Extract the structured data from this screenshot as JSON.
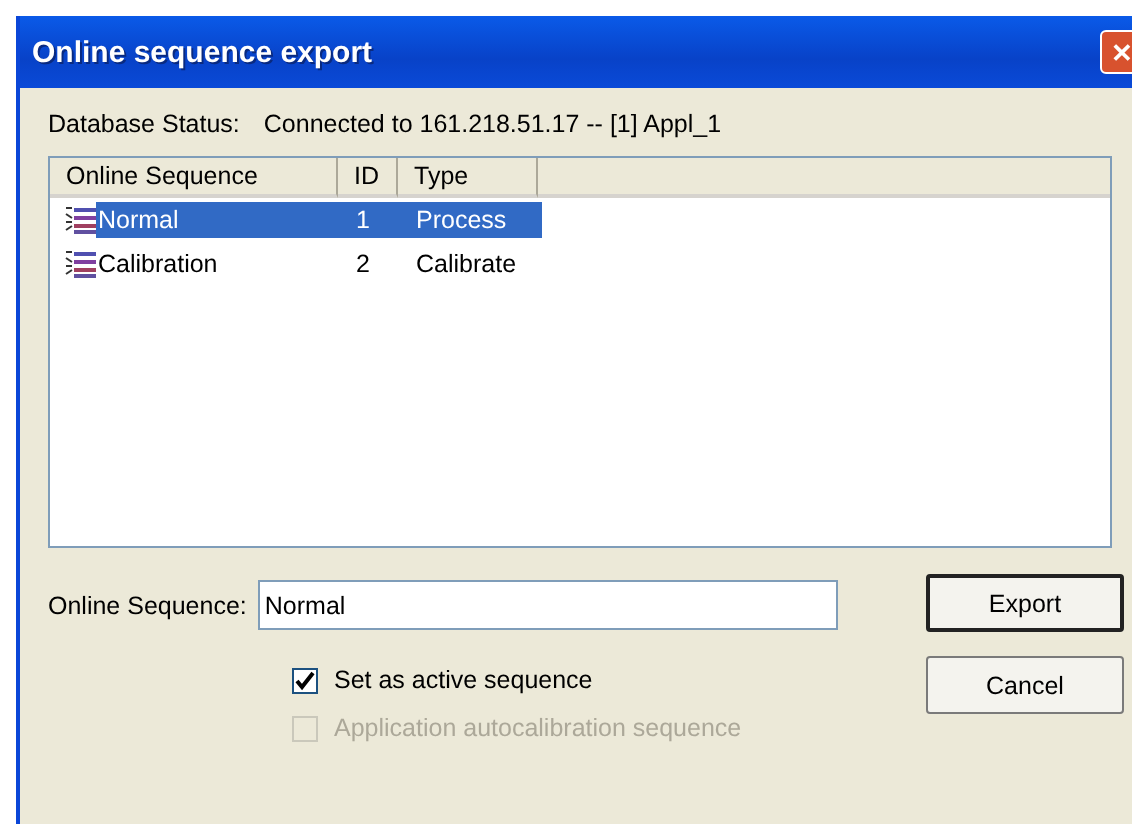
{
  "window": {
    "title": "Online sequence export",
    "close": "✕"
  },
  "database_status": {
    "label": "Database Status:",
    "value": "Connected to 161.218.51.17 -- [1] Appl_1"
  },
  "table": {
    "columns": [
      "Online Sequence",
      "ID",
      "Type"
    ],
    "rows": [
      {
        "name": "Normal",
        "id": "1",
        "type": "Process",
        "selected": true
      },
      {
        "name": "Calibration",
        "id": "2",
        "type": "Calibrate",
        "selected": false
      }
    ]
  },
  "sequence_field": {
    "label": "Online Sequence:",
    "value": "Normal"
  },
  "checkboxes": [
    {
      "label": "Set as active sequence",
      "checked": true,
      "disabled": false
    },
    {
      "label": "Application autocalibration sequence",
      "checked": false,
      "disabled": true
    }
  ],
  "buttons": [
    {
      "label": "Export",
      "default": true
    },
    {
      "label": "Cancel",
      "default": false
    }
  ]
}
